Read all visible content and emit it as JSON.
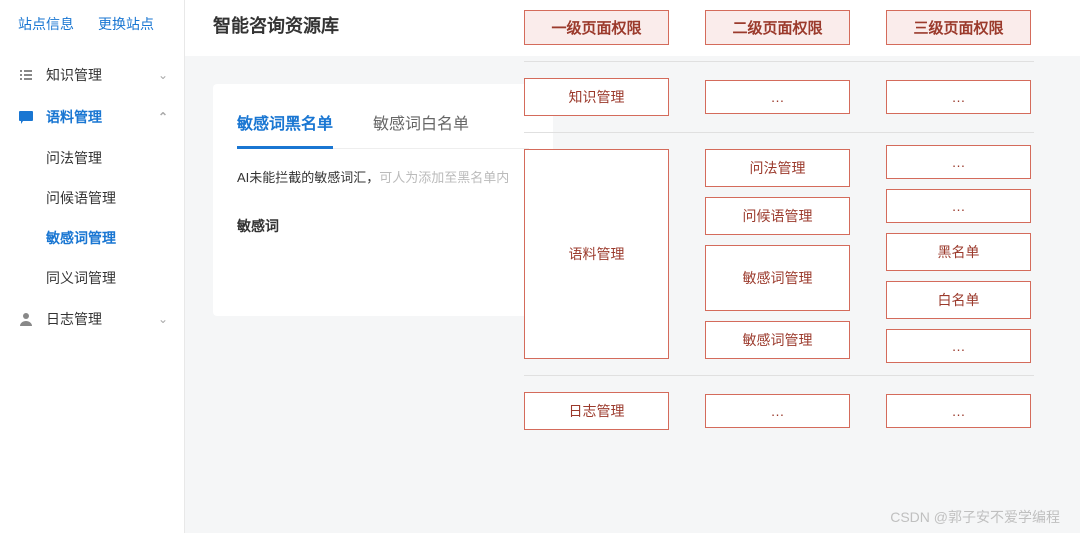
{
  "header": {
    "title": "智能咨询资源库"
  },
  "site_links": {
    "info": "站点信息",
    "switch": "更换站点"
  },
  "sidebar": {
    "items": [
      {
        "label": "知识管理",
        "icon": "list"
      },
      {
        "label": "语料管理",
        "icon": "message"
      },
      {
        "label": "日志管理",
        "icon": "user"
      }
    ],
    "sub_items": [
      {
        "label": "问法管理"
      },
      {
        "label": "问候语管理"
      },
      {
        "label": "敏感词管理"
      },
      {
        "label": "同义词管理"
      }
    ]
  },
  "content": {
    "tabs": [
      {
        "label": "敏感词黑名单"
      },
      {
        "label": "敏感词白名单"
      }
    ],
    "hint_part1": "AI未能拦截的敏感词汇，",
    "hint_part2": "可人为添加至黑名单内",
    "field_label": "敏感词"
  },
  "perm": {
    "headers": [
      "一级页面权限",
      "二级页面权限",
      "三级页面权限"
    ],
    "rows": [
      {
        "l1": "知识管理",
        "l2": [
          "…"
        ],
        "l3": [
          "…"
        ]
      },
      {
        "l1": "语料管理",
        "l2": [
          "问法管理",
          "问候语管理",
          "敏感词管理",
          "敏感词管理"
        ],
        "l3": [
          "…",
          "…",
          "黑名单",
          "白名单",
          "…"
        ]
      },
      {
        "l1": "日志管理",
        "l2": [
          "…"
        ],
        "l3": [
          "…"
        ]
      }
    ]
  },
  "watermark": "CSDN @郭子安不爱学编程"
}
